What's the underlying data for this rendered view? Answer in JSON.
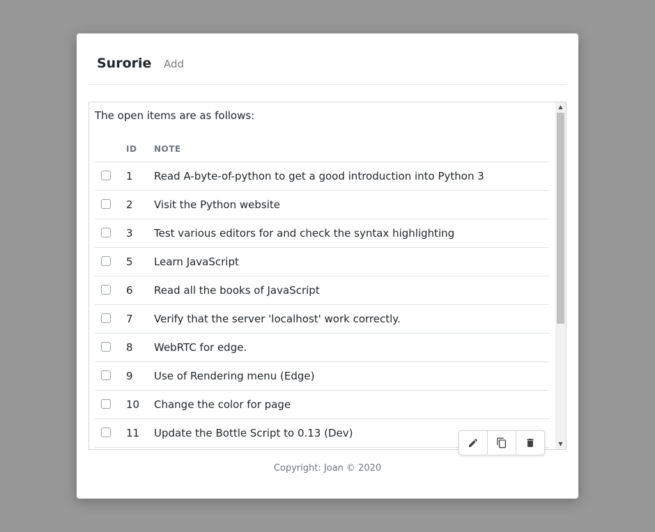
{
  "nav": {
    "brand": "Surorie",
    "add_label": "Add"
  },
  "content": {
    "intro": "The open items are as follows:",
    "columns": {
      "id": "ID",
      "note": "NOTE"
    },
    "rows": [
      {
        "id": "1",
        "note": "Read A-byte-of-python to get a good introduction into Python 3"
      },
      {
        "id": "2",
        "note": "Visit the Python website"
      },
      {
        "id": "3",
        "note": "Test various editors for and check the syntax highlighting"
      },
      {
        "id": "5",
        "note": "Learn JavaScript"
      },
      {
        "id": "6",
        "note": "Read all the books of JavaScript"
      },
      {
        "id": "7",
        "note": "Verify that the server 'localhost' work correctly."
      },
      {
        "id": "8",
        "note": "WebRTC for edge."
      },
      {
        "id": "9",
        "note": "Use of Rendering menu (Edge)"
      },
      {
        "id": "10",
        "note": "Change the color for page"
      },
      {
        "id": "11",
        "note": "Update the Bottle Script to 0.13 (Dev)"
      }
    ]
  },
  "toolbar": {
    "edit_icon": "pencil-icon",
    "copy_icon": "copy-icon",
    "delete_icon": "trash-icon"
  },
  "footer": {
    "copyright": "Copyright: Joan © 2020"
  },
  "colors": {
    "background": "#979797",
    "card": "#ffffff",
    "muted": "#6c757d",
    "border": "#dee2e6"
  }
}
